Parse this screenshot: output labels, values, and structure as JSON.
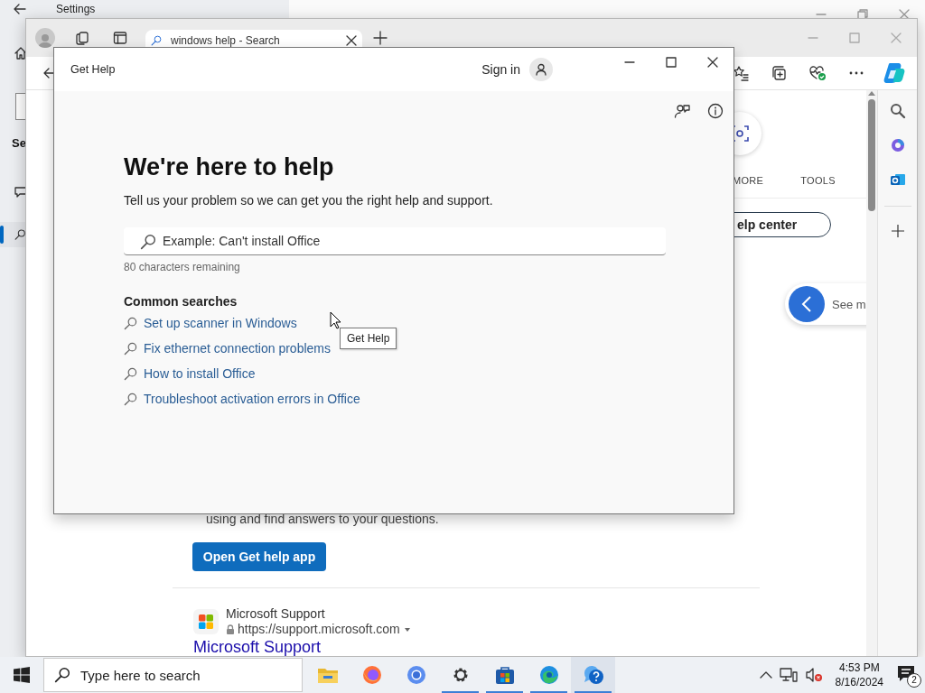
{
  "settings_window": {
    "title": "Settings",
    "nav_heading": "Se"
  },
  "browser": {
    "tab_title": "windows help - Search",
    "page": {
      "nav_tabs": [
        "MORE",
        "TOOLS"
      ],
      "help_center_button": "elp center",
      "see_more": "See m",
      "description": "using and find answers to your questions.",
      "open_app_button": "Open Get help app",
      "result": {
        "site_name": "Microsoft Support",
        "url": "https://support.microsoft.com",
        "title": "Microsoft Support"
      }
    }
  },
  "get_help": {
    "title": "Get Help",
    "sign_in": "Sign in",
    "heading": "We're here to help",
    "subtitle": "Tell us your problem so we can get you the right help and support.",
    "search": {
      "placeholder": "Example: Can't install Office"
    },
    "remaining": "80 characters remaining",
    "common_title": "Common searches",
    "common_searches": [
      "Set up scanner in Windows",
      "Fix ethernet connection problems",
      "How to install Office",
      "Troubleshoot activation errors in Office"
    ],
    "tooltip": "Get Help"
  },
  "taskbar": {
    "search_placeholder": "Type here to search",
    "apps": [
      {
        "kind": "explorer",
        "running": false,
        "active": false
      },
      {
        "kind": "firefox",
        "running": false,
        "active": false
      },
      {
        "kind": "chrome",
        "running": false,
        "active": false
      },
      {
        "kind": "settings",
        "running": true,
        "active": false
      },
      {
        "kind": "store",
        "running": true,
        "active": false
      },
      {
        "kind": "edge",
        "running": true,
        "active": false
      },
      {
        "kind": "help",
        "running": true,
        "active": true
      }
    ],
    "time": "4:53 PM",
    "date": "8/16/2024",
    "notifications": "2"
  }
}
